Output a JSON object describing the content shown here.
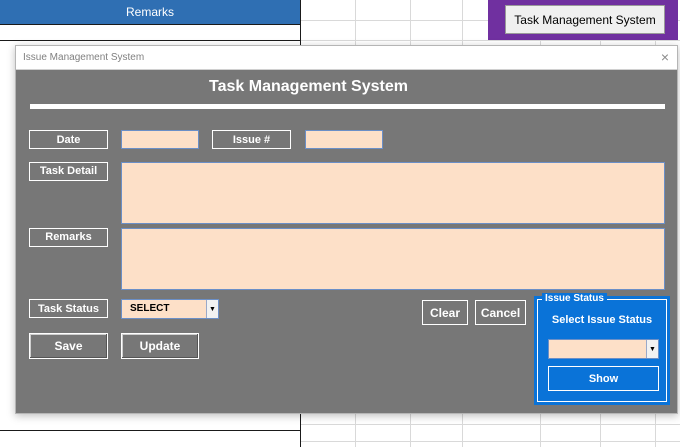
{
  "spreadsheet": {
    "column_header": "Remarks",
    "launch_button_label": "Task Management System"
  },
  "window": {
    "title": "Issue Management System",
    "close_symbol": "×"
  },
  "form": {
    "heading": "Task Management System",
    "date_label": "Date",
    "date_value": "",
    "issue_no_label": "Issue #",
    "issue_no_value": "",
    "task_detail_label": "Task Detail",
    "task_detail_value": "",
    "remarks_label": "Remarks",
    "remarks_value": "",
    "task_status_label": "Task Status",
    "task_status_value": "SELECT"
  },
  "buttons": {
    "save": "Save",
    "update": "Update",
    "clear": "Clear",
    "cancel": "Cancel"
  },
  "issue_status": {
    "frame_label": "Issue Status",
    "caption": "Select Issue Status",
    "selected_value": "",
    "show_button": "Show"
  },
  "colors": {
    "dialog_background": "#777777",
    "input_fill": "#fde0c8",
    "status_panel": "#0a73d8",
    "header_blue": "#2f6fb3",
    "launcher_purple": "#7030a0"
  },
  "icons": {
    "dropdown": "chevron-down-icon",
    "close": "close-icon"
  }
}
